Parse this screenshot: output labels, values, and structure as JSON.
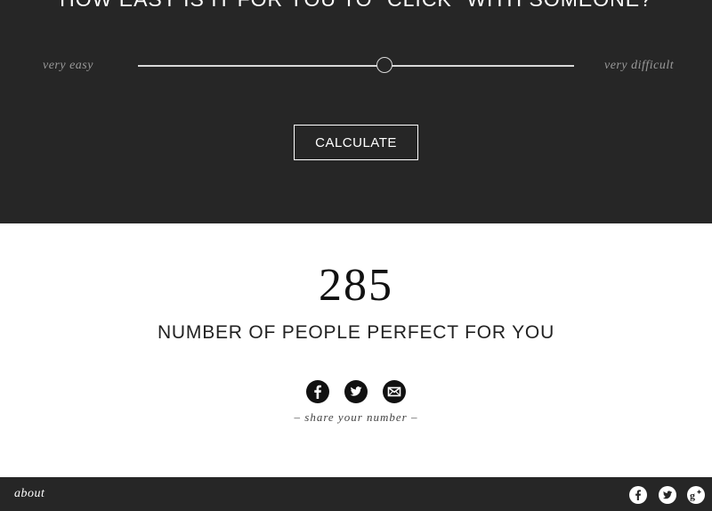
{
  "header": {
    "question": "HOW EASY IS IT FOR YOU TO \"CLICK\" WITH SOMEONE?"
  },
  "slider": {
    "left_label": "very easy",
    "right_label": "very difficult",
    "value": 0.565
  },
  "calculate_button": {
    "label": "CALCULATE"
  },
  "result": {
    "number": "285",
    "label": "NUMBER OF PEOPLE PERFECT FOR YOU"
  },
  "share": {
    "icons": [
      "facebook-icon",
      "twitter-icon",
      "email-icon"
    ],
    "caption": "– share your number –"
  },
  "footer": {
    "about_label": "about",
    "icons": [
      "facebook-icon",
      "twitter-icon",
      "google-plus-icon"
    ]
  },
  "colors": {
    "dark_background": "#262626",
    "light_background": "#ffffff",
    "text_dark": "#111111",
    "slider_track": "#d8d8d8"
  }
}
